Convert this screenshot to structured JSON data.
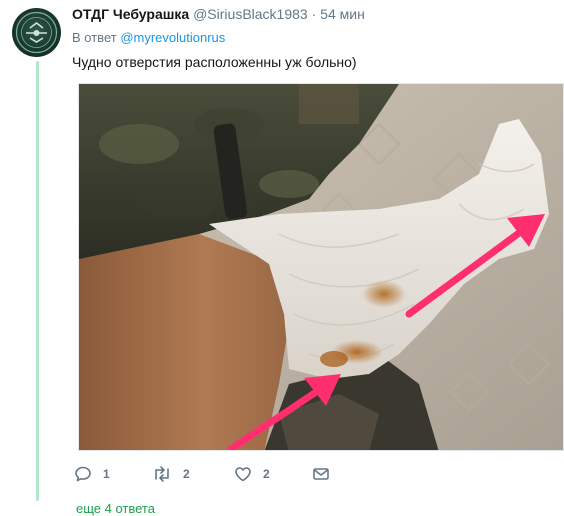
{
  "tweet": {
    "author_name": "ОТДГ Чебурашка",
    "handle": "@SiriusBlack1983",
    "separator": "·",
    "time": "54 мин",
    "reply_prefix": "В ответ",
    "reply_mention": "@myrevolutionrus",
    "text": "Чудно отверстия расположенны уж больно)"
  },
  "actions": {
    "reply_count": "1",
    "retweet_count": "2",
    "like_count": "2"
  },
  "more_replies": "еще 4 ответа",
  "icons": {
    "reply": "speech-bubble-icon",
    "retweet": "retweet-icon",
    "like": "heart-icon",
    "dm": "envelope-icon"
  },
  "colors": {
    "link": "#1b95e0",
    "more_link": "#1da14b",
    "muted": "#657786",
    "thread_line": "#b2e8c9",
    "arrow": "#ff2e6e"
  }
}
